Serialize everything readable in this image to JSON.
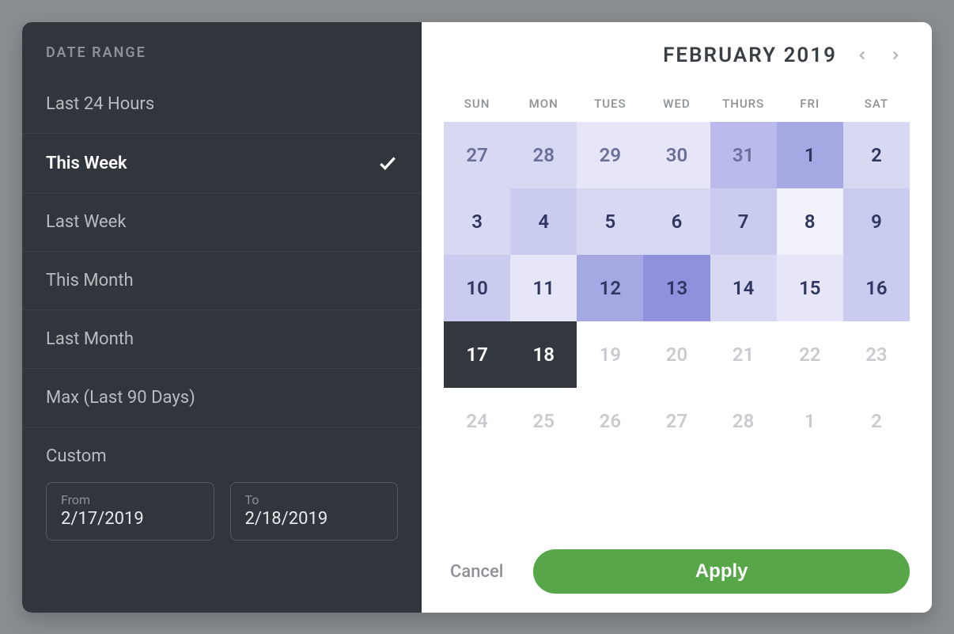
{
  "sidebar": {
    "title": "DATE RANGE",
    "items": [
      {
        "label": "Last 24 Hours",
        "selected": false
      },
      {
        "label": "This Week",
        "selected": true
      },
      {
        "label": "Last Week",
        "selected": false
      },
      {
        "label": "This Month",
        "selected": false
      },
      {
        "label": "Last Month",
        "selected": false
      },
      {
        "label": "Max (Last 90 Days)",
        "selected": false
      }
    ],
    "custom_label": "Custom",
    "from_label": "From",
    "to_label": "To",
    "from_value": "2/17/2019",
    "to_value": "2/18/2019"
  },
  "calendar": {
    "title": "FEBRUARY 2019",
    "dow": [
      "SUN",
      "MON",
      "TUES",
      "WED",
      "THURS",
      "FRI",
      "SAT"
    ],
    "cells": [
      {
        "n": "27",
        "heat": 3,
        "outside": true
      },
      {
        "n": "28",
        "heat": 3,
        "outside": true
      },
      {
        "n": "29",
        "heat": 2,
        "outside": true
      },
      {
        "n": "30",
        "heat": 2,
        "outside": true
      },
      {
        "n": "31",
        "heat": 5,
        "outside": true
      },
      {
        "n": "1",
        "heat": 6
      },
      {
        "n": "2",
        "heat": 3
      },
      {
        "n": "3",
        "heat": 3
      },
      {
        "n": "4",
        "heat": 4
      },
      {
        "n": "5",
        "heat": 3
      },
      {
        "n": "6",
        "heat": 3
      },
      {
        "n": "7",
        "heat": 4
      },
      {
        "n": "8",
        "heat": 1
      },
      {
        "n": "9",
        "heat": 4
      },
      {
        "n": "10",
        "heat": 4
      },
      {
        "n": "11",
        "heat": 2
      },
      {
        "n": "12",
        "heat": 6
      },
      {
        "n": "13",
        "heat": 7
      },
      {
        "n": "14",
        "heat": 3
      },
      {
        "n": "15",
        "heat": 2
      },
      {
        "n": "16",
        "heat": 4
      },
      {
        "n": "17",
        "selected": true
      },
      {
        "n": "18",
        "selected": true
      },
      {
        "n": "19",
        "outside": true,
        "future": true
      },
      {
        "n": "20",
        "outside": true,
        "future": true
      },
      {
        "n": "21",
        "outside": true,
        "future": true
      },
      {
        "n": "22",
        "outside": true,
        "future": true
      },
      {
        "n": "23",
        "outside": true,
        "future": true
      },
      {
        "n": "24",
        "outside": true,
        "future": true
      },
      {
        "n": "25",
        "outside": true,
        "future": true
      },
      {
        "n": "26",
        "outside": true,
        "future": true
      },
      {
        "n": "27",
        "outside": true,
        "future": true
      },
      {
        "n": "28",
        "outside": true,
        "future": true
      },
      {
        "n": "1",
        "outside": true,
        "future": true
      },
      {
        "n": "2",
        "outside": true,
        "future": true
      }
    ],
    "heat_colors": {
      "1": "#f2f2fb",
      "2": "#e6e6f8",
      "3": "#d7d9f3",
      "4": "#c9cbef",
      "5": "#babbea",
      "6": "#a6a8e4",
      "7": "#8f91dd"
    }
  },
  "actions": {
    "cancel": "Cancel",
    "apply": "Apply"
  }
}
